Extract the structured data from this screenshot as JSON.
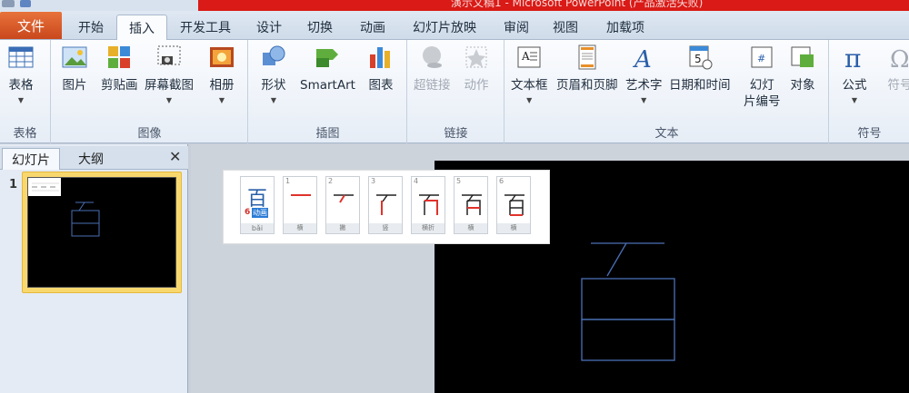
{
  "window": {
    "title": "演示文稿1 - Microsoft PowerPoint (产品激活失败)"
  },
  "tabs": {
    "file": "文件",
    "items": [
      "开始",
      "插入",
      "开发工具",
      "设计",
      "切换",
      "动画",
      "幻灯片放映",
      "审阅",
      "视图",
      "加载项"
    ],
    "active": "插入"
  },
  "ribbon": {
    "groups": {
      "tables": "表格",
      "images": "图像",
      "illustrations": "插图",
      "links": "链接",
      "text": "文本",
      "symbols": "符号"
    },
    "buttons": {
      "table": "表格",
      "picture": "图片",
      "clipart": "剪贴画",
      "screenshot": "屏幕截图",
      "album": "相册",
      "shapes": "形状",
      "smartart": "SmartArt",
      "chart": "图表",
      "hyperlink": "超链接",
      "action": "动作",
      "textbox": "文本框",
      "header_footer": "页眉和页脚",
      "wordart": "艺术字",
      "datetime": "日期和时间",
      "slide_number_1": "幻灯",
      "slide_number_2": "片编号",
      "object": "对象",
      "equation": "公式",
      "symbol": "符号"
    }
  },
  "left_pane": {
    "tab_slides": "幻灯片",
    "tab_outline": "大纲",
    "slide_number": "1"
  },
  "stroke_panel": {
    "character": "百",
    "stroke_count": "6",
    "anim_label": "动画",
    "pinyin": "bǎi",
    "strokes": [
      {
        "num": "1",
        "name": "横"
      },
      {
        "num": "2",
        "name": "撇"
      },
      {
        "num": "3",
        "name": "竖"
      },
      {
        "num": "4",
        "name": "横折"
      },
      {
        "num": "5",
        "name": "横"
      },
      {
        "num": "6",
        "name": "横"
      }
    ]
  },
  "colors": {
    "file_tab": "#d9541e",
    "titlebar_accent": "#d91a16",
    "slide_bg": "#000000",
    "shape_stroke": "#4a6fb5",
    "stroke_highlight": "#e0322c"
  }
}
